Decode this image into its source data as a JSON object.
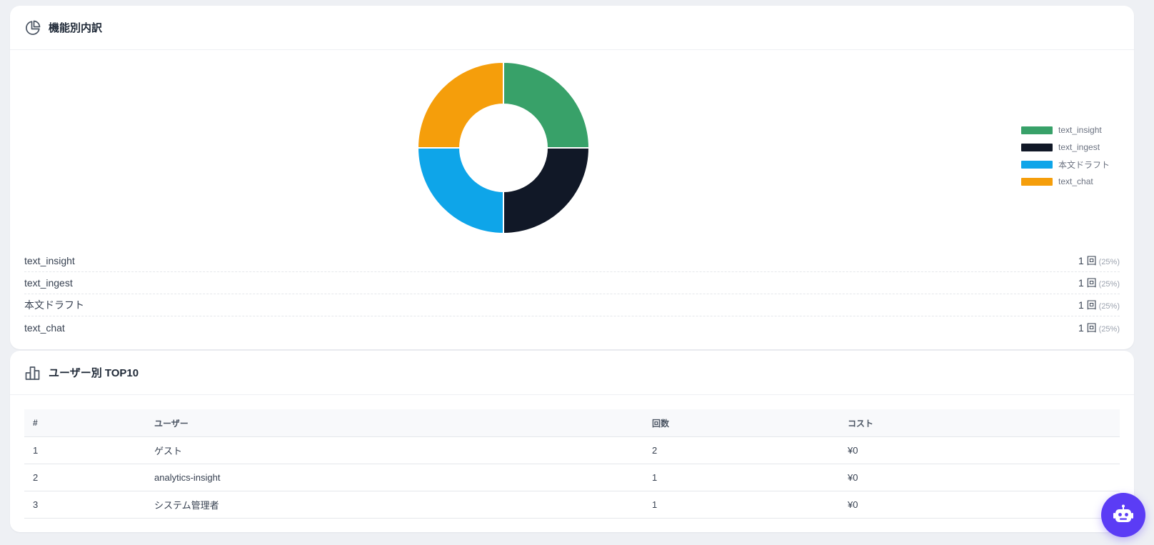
{
  "breakdown_card": {
    "title": "機能別内訳",
    "icon": "pie-chart-icon",
    "items": [
      {
        "name": "text_insight",
        "count": "1 回",
        "pct": "(25%)"
      },
      {
        "name": "text_ingest",
        "count": "1 回",
        "pct": "(25%)"
      },
      {
        "name": "本文ドラフト",
        "count": "1 回",
        "pct": "(25%)"
      },
      {
        "name": "text_chat",
        "count": "1 回",
        "pct": "(25%)"
      }
    ]
  },
  "chart_data": {
    "type": "pie",
    "donut": true,
    "categories": [
      "text_insight",
      "text_ingest",
      "本文ドラフト",
      "text_chat"
    ],
    "values": [
      1,
      1,
      1,
      1
    ],
    "colors": [
      "#38a169",
      "#111827",
      "#0ea5e9",
      "#f59e0b"
    ],
    "legend": "right",
    "title": ""
  },
  "users_card": {
    "title": "ユーザー別 TOP10",
    "icon": "bar-chart-icon",
    "columns": [
      "#",
      "ユーザー",
      "回数",
      "コスト"
    ],
    "rows": [
      [
        "1",
        "ゲスト",
        "2",
        "¥0"
      ],
      [
        "2",
        "analytics-insight",
        "1",
        "¥0"
      ],
      [
        "3",
        "システム管理者",
        "1",
        "¥0"
      ]
    ]
  },
  "assistant_button": {
    "icon": "robot-icon"
  }
}
